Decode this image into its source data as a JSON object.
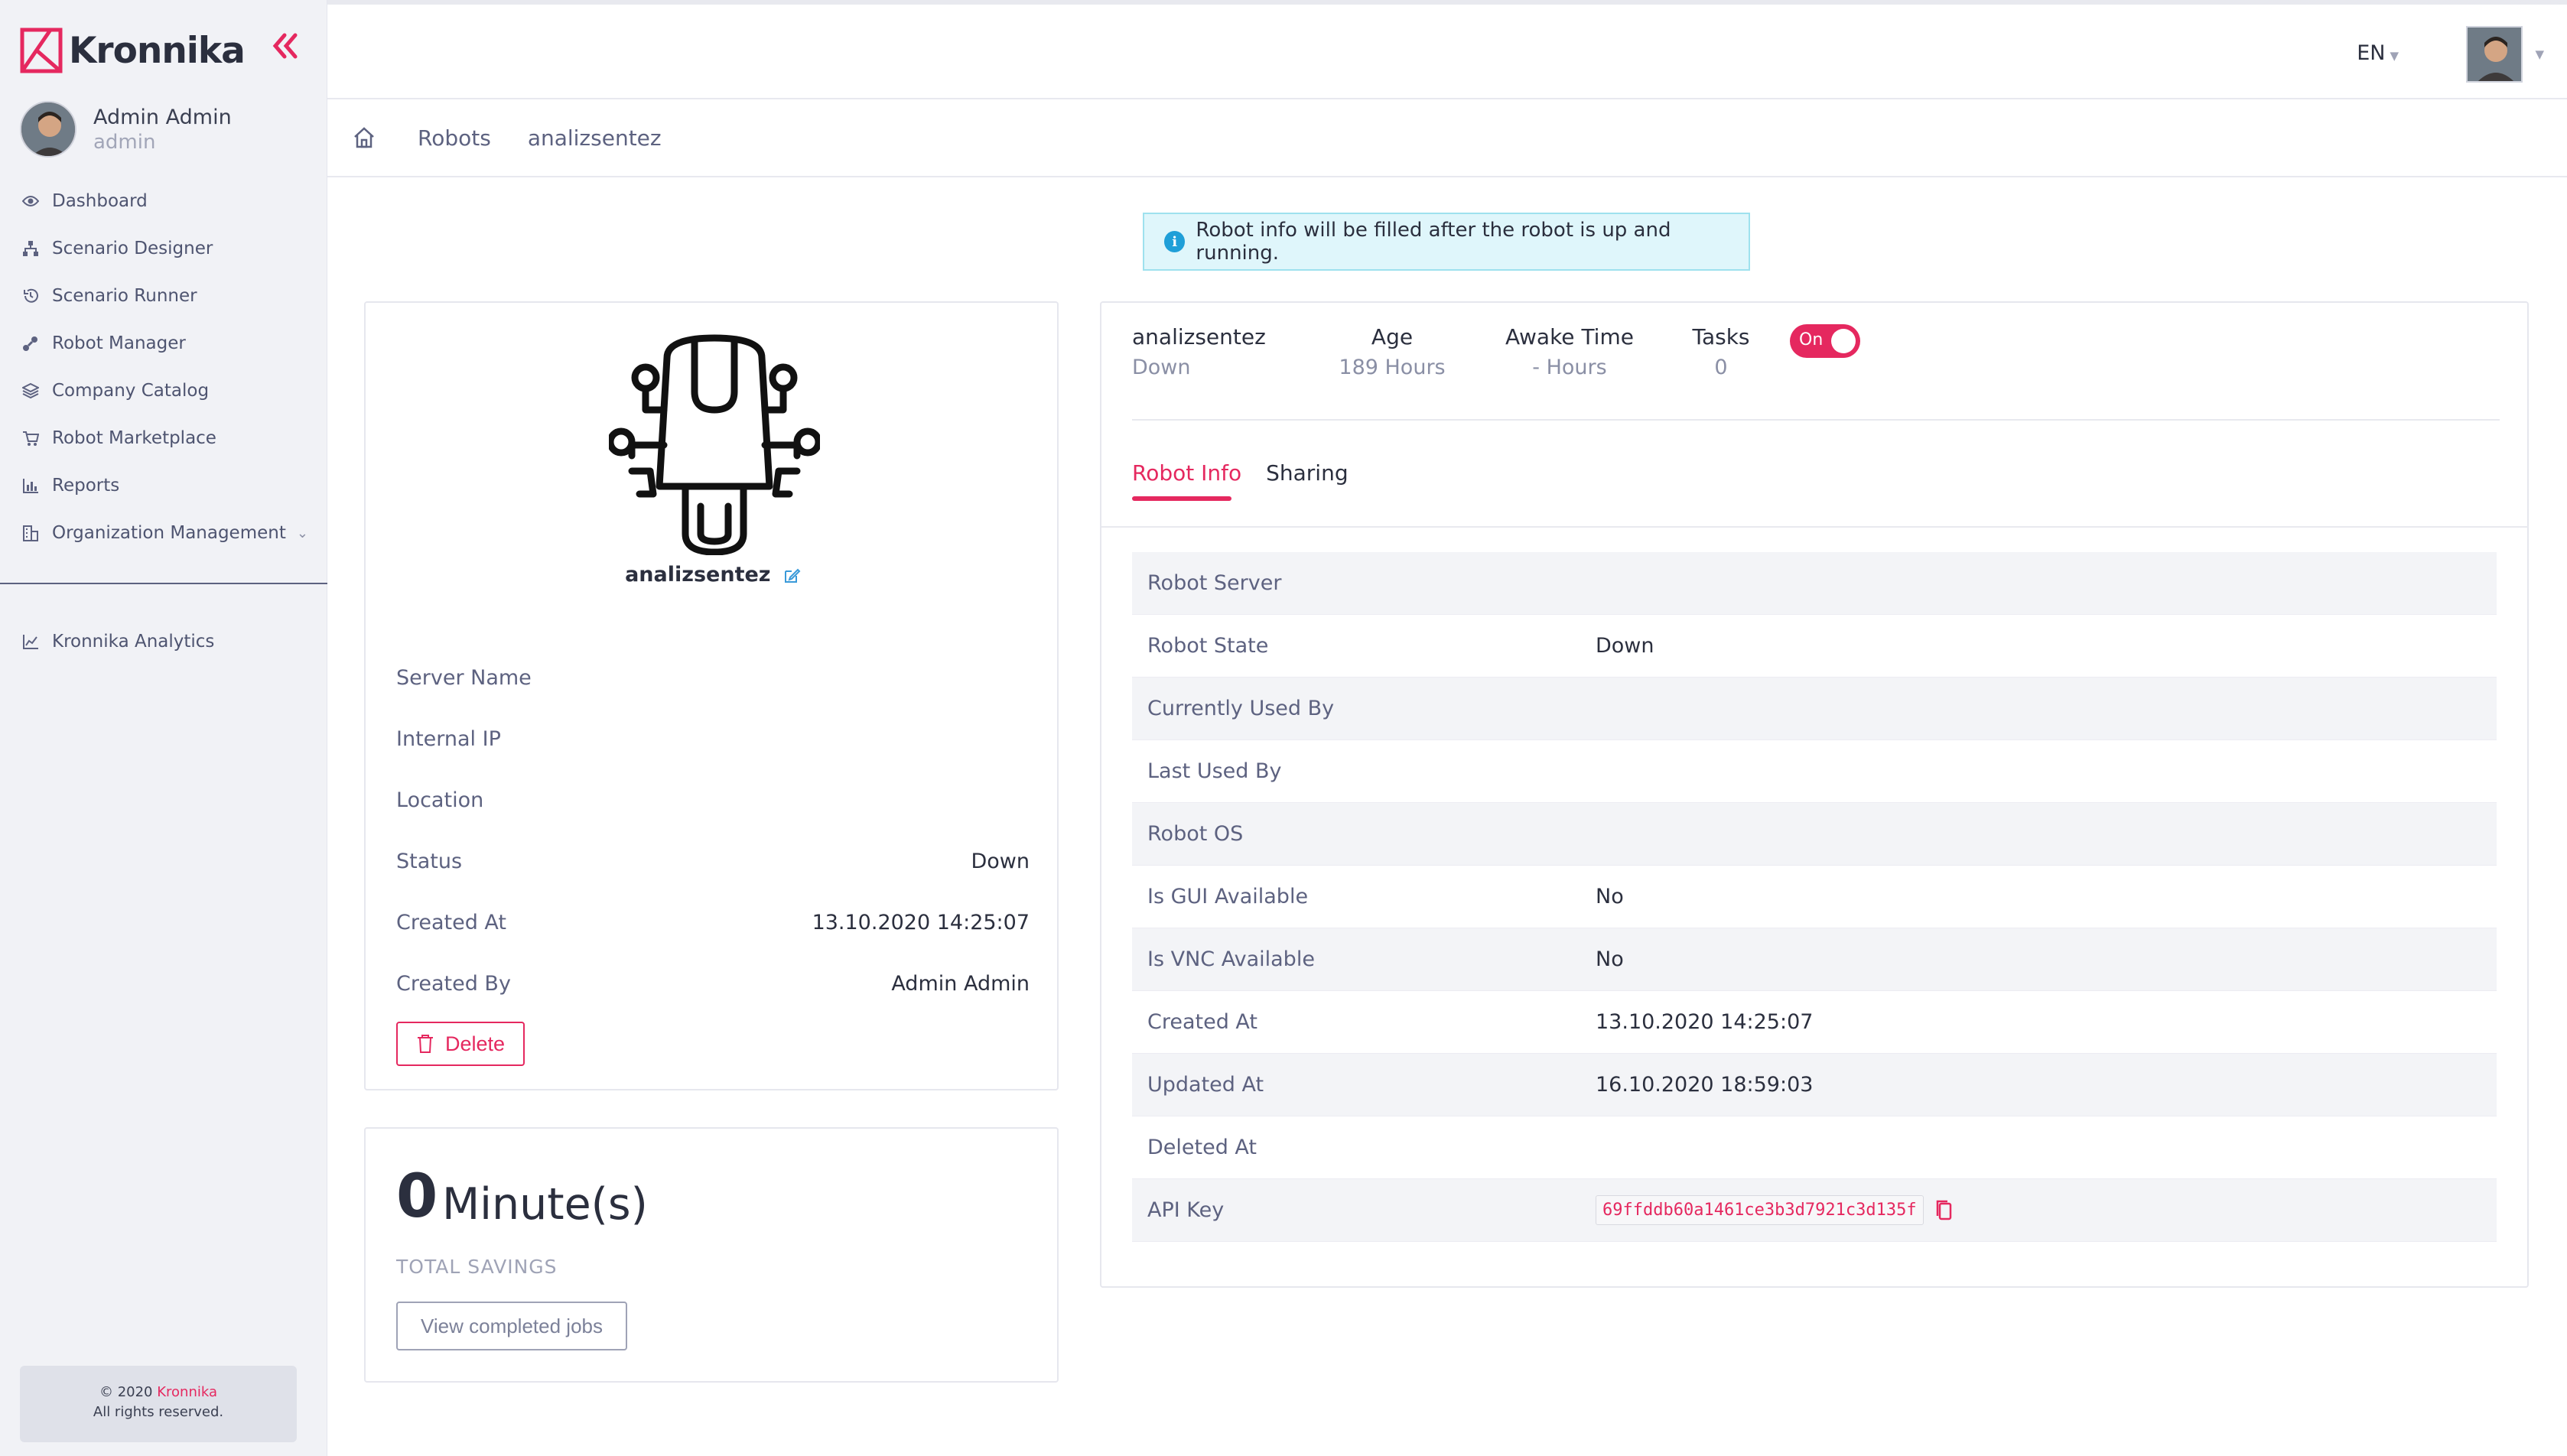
{
  "app": {
    "brand": "Kronnika",
    "accent": "#e5285f"
  },
  "sidebar": {
    "user_name": "Admin Admin",
    "user_role": "admin",
    "items": [
      {
        "label": "Dashboard",
        "icon": "eye-icon"
      },
      {
        "label": "Scenario Designer",
        "icon": "sitemap-icon"
      },
      {
        "label": "Scenario Runner",
        "icon": "history-icon"
      },
      {
        "label": "Robot Manager",
        "icon": "robot-arm-icon"
      },
      {
        "label": "Company Catalog",
        "icon": "layers-icon"
      },
      {
        "label": "Robot Marketplace",
        "icon": "cart-icon"
      },
      {
        "label": "Reports",
        "icon": "bar-chart-icon"
      },
      {
        "label": "Organization Management",
        "icon": "building-icon"
      }
    ],
    "analytics_label": "Kronnika Analytics",
    "footer_copyright": "© 2020",
    "footer_brand": "Kronnika",
    "footer_rights": "All rights reserved."
  },
  "topbar": {
    "language": "EN"
  },
  "breadcrumb": {
    "items": [
      "Robots",
      "analizsentez"
    ]
  },
  "alert": {
    "text": "Robot info will be filled after the robot is up and running."
  },
  "robot_card": {
    "name": "analizsentez",
    "fields": [
      {
        "key": "Server Name",
        "value": ""
      },
      {
        "key": "Internal IP",
        "value": ""
      },
      {
        "key": "Location",
        "value": ""
      },
      {
        "key": "Status",
        "value": "Down"
      },
      {
        "key": "Created At",
        "value": "13.10.2020 14:25:07"
      },
      {
        "key": "Created By",
        "value": "Admin Admin"
      }
    ],
    "delete_label": "Delete"
  },
  "savings": {
    "value": "0",
    "unit": "Minute(s)",
    "label": "TOTAL SAVINGS",
    "button_label": "View completed jobs"
  },
  "detail": {
    "stats": {
      "name": "analizsentez",
      "name_sub": "Down",
      "age_label": "Age",
      "age_value": "189 Hours",
      "awake_label": "Awake Time",
      "awake_value": "- Hours",
      "tasks_label": "Tasks",
      "tasks_value": "0",
      "toggle_label": "On"
    },
    "tabs": [
      "Robot Info",
      "Sharing"
    ],
    "info_rows": [
      {
        "key": "Robot Server",
        "value": ""
      },
      {
        "key": "Robot State",
        "value": "Down"
      },
      {
        "key": "Currently Used By",
        "value": ""
      },
      {
        "key": "Last Used By",
        "value": ""
      },
      {
        "key": "Robot OS",
        "value": ""
      },
      {
        "key": "Is GUI Available",
        "value": "No"
      },
      {
        "key": "Is VNC Available",
        "value": "No"
      },
      {
        "key": "Created At",
        "value": "13.10.2020 14:25:07"
      },
      {
        "key": "Updated At",
        "value": "16.10.2020 18:59:03"
      },
      {
        "key": "Deleted At",
        "value": ""
      }
    ],
    "api_key_label": "API Key",
    "api_key_value": "69ffddb60a1461ce3b3d7921c3d135f"
  }
}
